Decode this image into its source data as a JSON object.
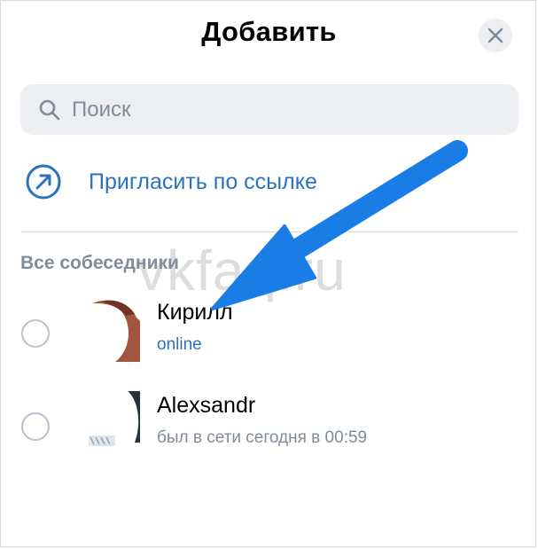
{
  "header": {
    "title": "Добавить",
    "close_icon": "close-icon"
  },
  "search": {
    "placeholder": "Поиск",
    "icon": "search-icon"
  },
  "invite": {
    "label": "Пригласить по ссылке",
    "icon": "arrow-up-right-circle-icon"
  },
  "section": {
    "title": "Все собеседники"
  },
  "contacts": [
    {
      "name": "Кирилл",
      "status": "online",
      "selected": false
    },
    {
      "name": "Alexsandr",
      "status": "был в сети сегодня в 00:59",
      "selected": false
    }
  ],
  "watermark": "vkfaq.ru",
  "colors": {
    "accent": "#2b73be",
    "secondary_text": "#818c99",
    "field_background": "#eceef1",
    "annotation_arrow": "#1a7de6"
  }
}
